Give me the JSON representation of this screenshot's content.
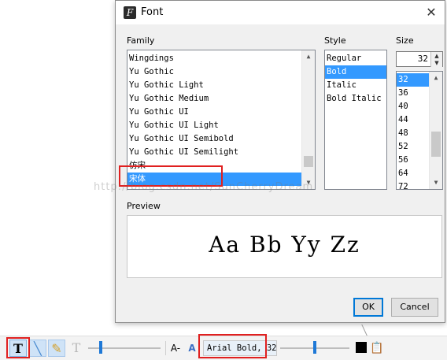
{
  "dialog": {
    "title": "Font",
    "family_label": "Family",
    "style_label": "Style",
    "size_label": "Size",
    "preview_label": "Preview",
    "preview_text": "Aa Bb Yy Zz",
    "ok_label": "OK",
    "cancel_label": "Cancel",
    "size_value": "32",
    "families": [
      "Wingdings",
      "Yu Gothic",
      "Yu Gothic Light",
      "Yu Gothic Medium",
      "Yu Gothic UI",
      "Yu Gothic UI Light",
      "Yu Gothic UI Semibold",
      "Yu Gothic UI Semilight",
      "仿宋",
      "宋体"
    ],
    "selected_family": "宋体",
    "styles": [
      "Regular",
      "Bold",
      "Italic",
      "Bold Italic"
    ],
    "selected_style": "Bold",
    "sizes": [
      "32",
      "36",
      "40",
      "44",
      "48",
      "52",
      "56",
      "64",
      "72"
    ],
    "selected_size": "32"
  },
  "watermark": "http://blog.csdn.net/SunCherryDream",
  "toolbar": {
    "font_field": "Arial Bold, 32",
    "a_minus": "A-",
    "a_blue": "A"
  },
  "colors": {
    "selection": "#3399ff",
    "highlight_box": "#e02020",
    "slider_thumb": "#1e78d6",
    "color_swatch": "#000000"
  }
}
